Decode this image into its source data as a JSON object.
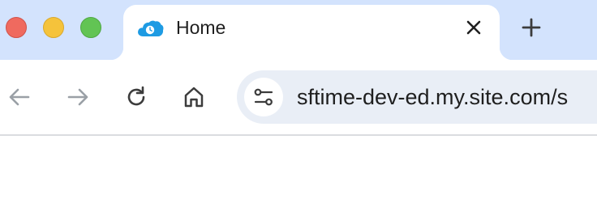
{
  "window": {
    "controls": [
      "close",
      "minimize",
      "maximize"
    ],
    "colors": {
      "close": "#ef6a5f",
      "minimize": "#f5c33b",
      "maximize": "#62c454",
      "tabbar": "#d3e3fd"
    }
  },
  "tab": {
    "title": "Home",
    "favicon": "salesforce-cloud-icon",
    "close_icon": "close-icon"
  },
  "new_tab_icon": "plus-icon",
  "toolbar": {
    "back_icon": "arrow-left-icon",
    "forward_icon": "arrow-right-icon",
    "reload_icon": "reload-icon",
    "home_icon": "home-icon",
    "site_info_icon": "tune-icon"
  },
  "address_bar": {
    "url": "sftime-dev-ed.my.site.com/s"
  }
}
